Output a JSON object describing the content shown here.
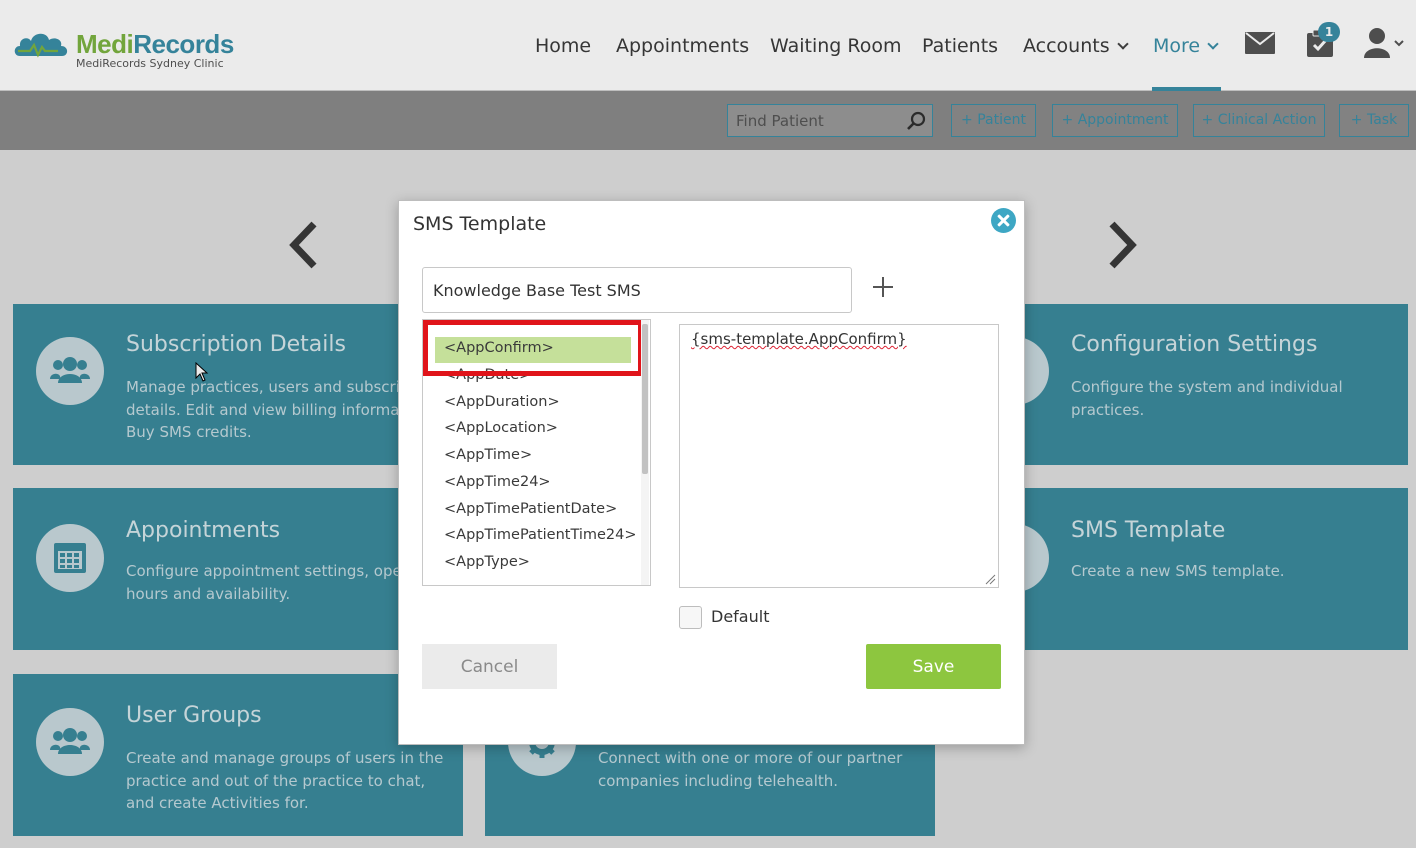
{
  "brand": {
    "name_part1": "Medi",
    "name_part2": "Records",
    "clinic": "MediRecords Sydney Clinic"
  },
  "nav": {
    "items": [
      {
        "label": "Home"
      },
      {
        "label": "Appointments"
      },
      {
        "label": "Waiting Room"
      },
      {
        "label": "Patients"
      },
      {
        "label": "Accounts"
      },
      {
        "label": "More"
      }
    ],
    "active": "More",
    "icons": [
      "mail-icon",
      "tasks-icon",
      "user-icon"
    ],
    "tasks_badge": "1"
  },
  "toolbar": {
    "search_placeholder": "Find Patient",
    "buttons": [
      {
        "label": "+ Patient"
      },
      {
        "label": "+ Appointment"
      },
      {
        "label": "+ Clinical Action"
      },
      {
        "label": "+ Task"
      }
    ]
  },
  "cards": [
    {
      "title": "Subscription Details",
      "desc": "Manage practices, users and subscrip details. Edit and view billing informati Buy SMS credits.",
      "icon": "users-icon"
    },
    {
      "title": "Configuration Settings",
      "desc": "Configure the system and individual practices.",
      "icon": "gear-icon"
    },
    {
      "title": "Appointments",
      "desc": "Configure appointment settings, oper hours and availability.",
      "icon": "calendar-icon"
    },
    {
      "title": "SMS Template",
      "desc": "Create a new SMS template.",
      "icon": "sms-icon"
    },
    {
      "title": "User Groups",
      "desc": "Create and manage groups of users in the practice and out of the practice to chat, and create Activities for.",
      "icon": "users-icon"
    },
    {
      "title": "",
      "desc": "Connect with one or more of our partner companies including telehealth.",
      "icon": "gear-icon"
    }
  ],
  "modal": {
    "title": "SMS Template",
    "template_name": "Knowledge Base Test SMS",
    "tags": [
      "<AppConfirm>",
      "<AppDate>",
      "<AppDuration>",
      "<AppLocation>",
      "<AppTime>",
      "<AppTime24>",
      "<AppTimePatientDate>",
      "<AppTimePatientTime24>",
      "<AppType>"
    ],
    "selected_tag": "<AppConfirm>",
    "body_text": "{sms-template.AppConfirm}",
    "default_label": "Default",
    "default_checked": false,
    "cancel_label": "Cancel",
    "save_label": "Save"
  },
  "colors": {
    "teal": "#3a8fa8",
    "card": "#3b8a9d",
    "save_green": "#8dc63f",
    "selected_tag": "#c5e09a",
    "highlight_red": "#e0141a"
  }
}
